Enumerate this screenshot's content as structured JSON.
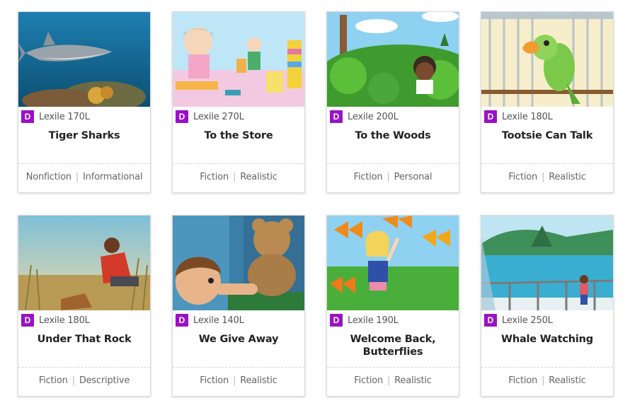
{
  "books": [
    {
      "title": "Tiger Sharks",
      "lexile": "Lexile 170L",
      "level": "D",
      "genre": "Nonfiction",
      "subgenre": "Informational",
      "image": "tiger-shark-illustration"
    },
    {
      "title": "To the Store",
      "lexile": "Lexile 270L",
      "level": "D",
      "genre": "Fiction",
      "subgenre": "Realistic",
      "image": "children-stacking-blocks-illustration"
    },
    {
      "title": "To the Woods",
      "lexile": "Lexile 200L",
      "level": "D",
      "genre": "Fiction",
      "subgenre": "Personal",
      "image": "girl-in-bushes-illustration"
    },
    {
      "title": "Tootsie Can Talk",
      "lexile": "Lexile 180L",
      "level": "D",
      "genre": "Fiction",
      "subgenre": "Realistic",
      "image": "parrot-in-cage-illustration"
    },
    {
      "title": "Under That Rock",
      "lexile": "Lexile 180L",
      "level": "D",
      "genre": "Fiction",
      "subgenre": "Descriptive",
      "image": "boy-in-grass-illustration"
    },
    {
      "title": "We Give Away",
      "lexile": "Lexile 140L",
      "level": "D",
      "genre": "Fiction",
      "subgenre": "Realistic",
      "image": "boy-with-teddy-bear-illustration"
    },
    {
      "title": "Welcome Back, Butterflies",
      "lexile": "Lexile 190L",
      "level": "D",
      "genre": "Fiction",
      "subgenre": "Realistic",
      "image": "girl-with-butterflies-illustration"
    },
    {
      "title": "Whale Watching",
      "lexile": "Lexile 250L",
      "level": "D",
      "genre": "Fiction",
      "subgenre": "Realistic",
      "image": "girl-at-ocean-railing-illustration"
    }
  ],
  "colors": {
    "level_badge": "#9b10c9"
  }
}
